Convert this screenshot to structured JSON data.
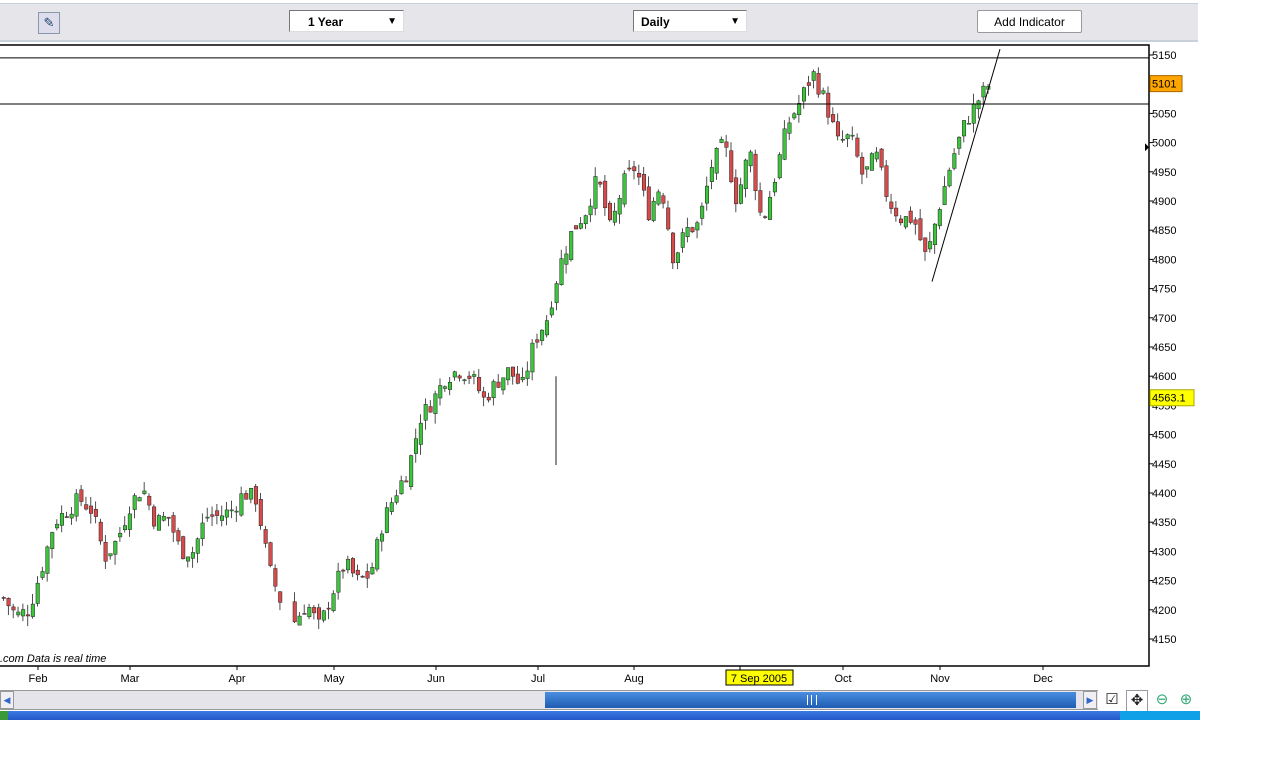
{
  "toolbar": {
    "period": "1 Year",
    "interval": "Daily",
    "add_indicator": "Add Indicator",
    "dropdown_arrow": "▼",
    "tool_icon": "chart-draw-icon"
  },
  "chart_data": {
    "type": "candlestick",
    "title": "",
    "source_note": ".com Data is real time",
    "ylim": [
      4110,
      5170
    ],
    "y_ticks": [
      4150,
      4200,
      4250,
      4300,
      4350,
      4400,
      4450,
      4500,
      4550,
      4600,
      4650,
      4700,
      4750,
      4800,
      4850,
      4900,
      4950,
      5000,
      5050,
      5100,
      5150
    ],
    "y_tick_labels": [
      "4150",
      "4200",
      "4250",
      "4300",
      "4350",
      "4400",
      "4450",
      "4500",
      "4550",
      "4600",
      "4650",
      "4700",
      "4750",
      "4800",
      "4850",
      "4900",
      "4950",
      "5000",
      "5050",
      "5100",
      "5150"
    ],
    "x_labels": [
      "Feb",
      "Mar",
      "Apr",
      "May",
      "Jun",
      "Jul",
      "Aug",
      "Sep",
      "Oct",
      "Nov",
      "Dec"
    ],
    "crosshair_date": "7 Sep 2005",
    "last_price": "5101",
    "marker_price": "4563.1",
    "horizontal_lines": [
      5145,
      5066
    ],
    "trendline": {
      "from_price": 4762,
      "to_price": 5160
    },
    "approx_closes": [
      4220,
      4190,
      4200,
      4270,
      4350,
      4370,
      4390,
      4370,
      4290,
      4320,
      4380,
      4410,
      4350,
      4360,
      4300,
      4300,
      4360,
      4360,
      4370,
      4400,
      4390,
      4270,
      4210,
      4180,
      4210,
      4170,
      4230,
      4280,
      4250,
      4260,
      4350,
      4400,
      4440,
      4530,
      4560,
      4600,
      4610,
      4600,
      4560,
      4590,
      4610,
      4580,
      4660,
      4700,
      4790,
      4850,
      4880,
      4940,
      4850,
      4930,
      4960,
      4880,
      4930,
      4800,
      4850,
      4860,
      4960,
      5000,
      4900,
      4990,
      4860,
      4940,
      5030,
      5070,
      5120,
      5070,
      5000,
      5010,
      4940,
      4980,
      4900,
      4870,
      4870,
      4800,
      4890,
      4970,
      5030,
      5070,
      5101
    ],
    "colors": {
      "up": "#3cc43c",
      "down": "#d84a4a",
      "last_price_bg": "#ffa500",
      "marker_bg": "#ffff00"
    }
  }
}
